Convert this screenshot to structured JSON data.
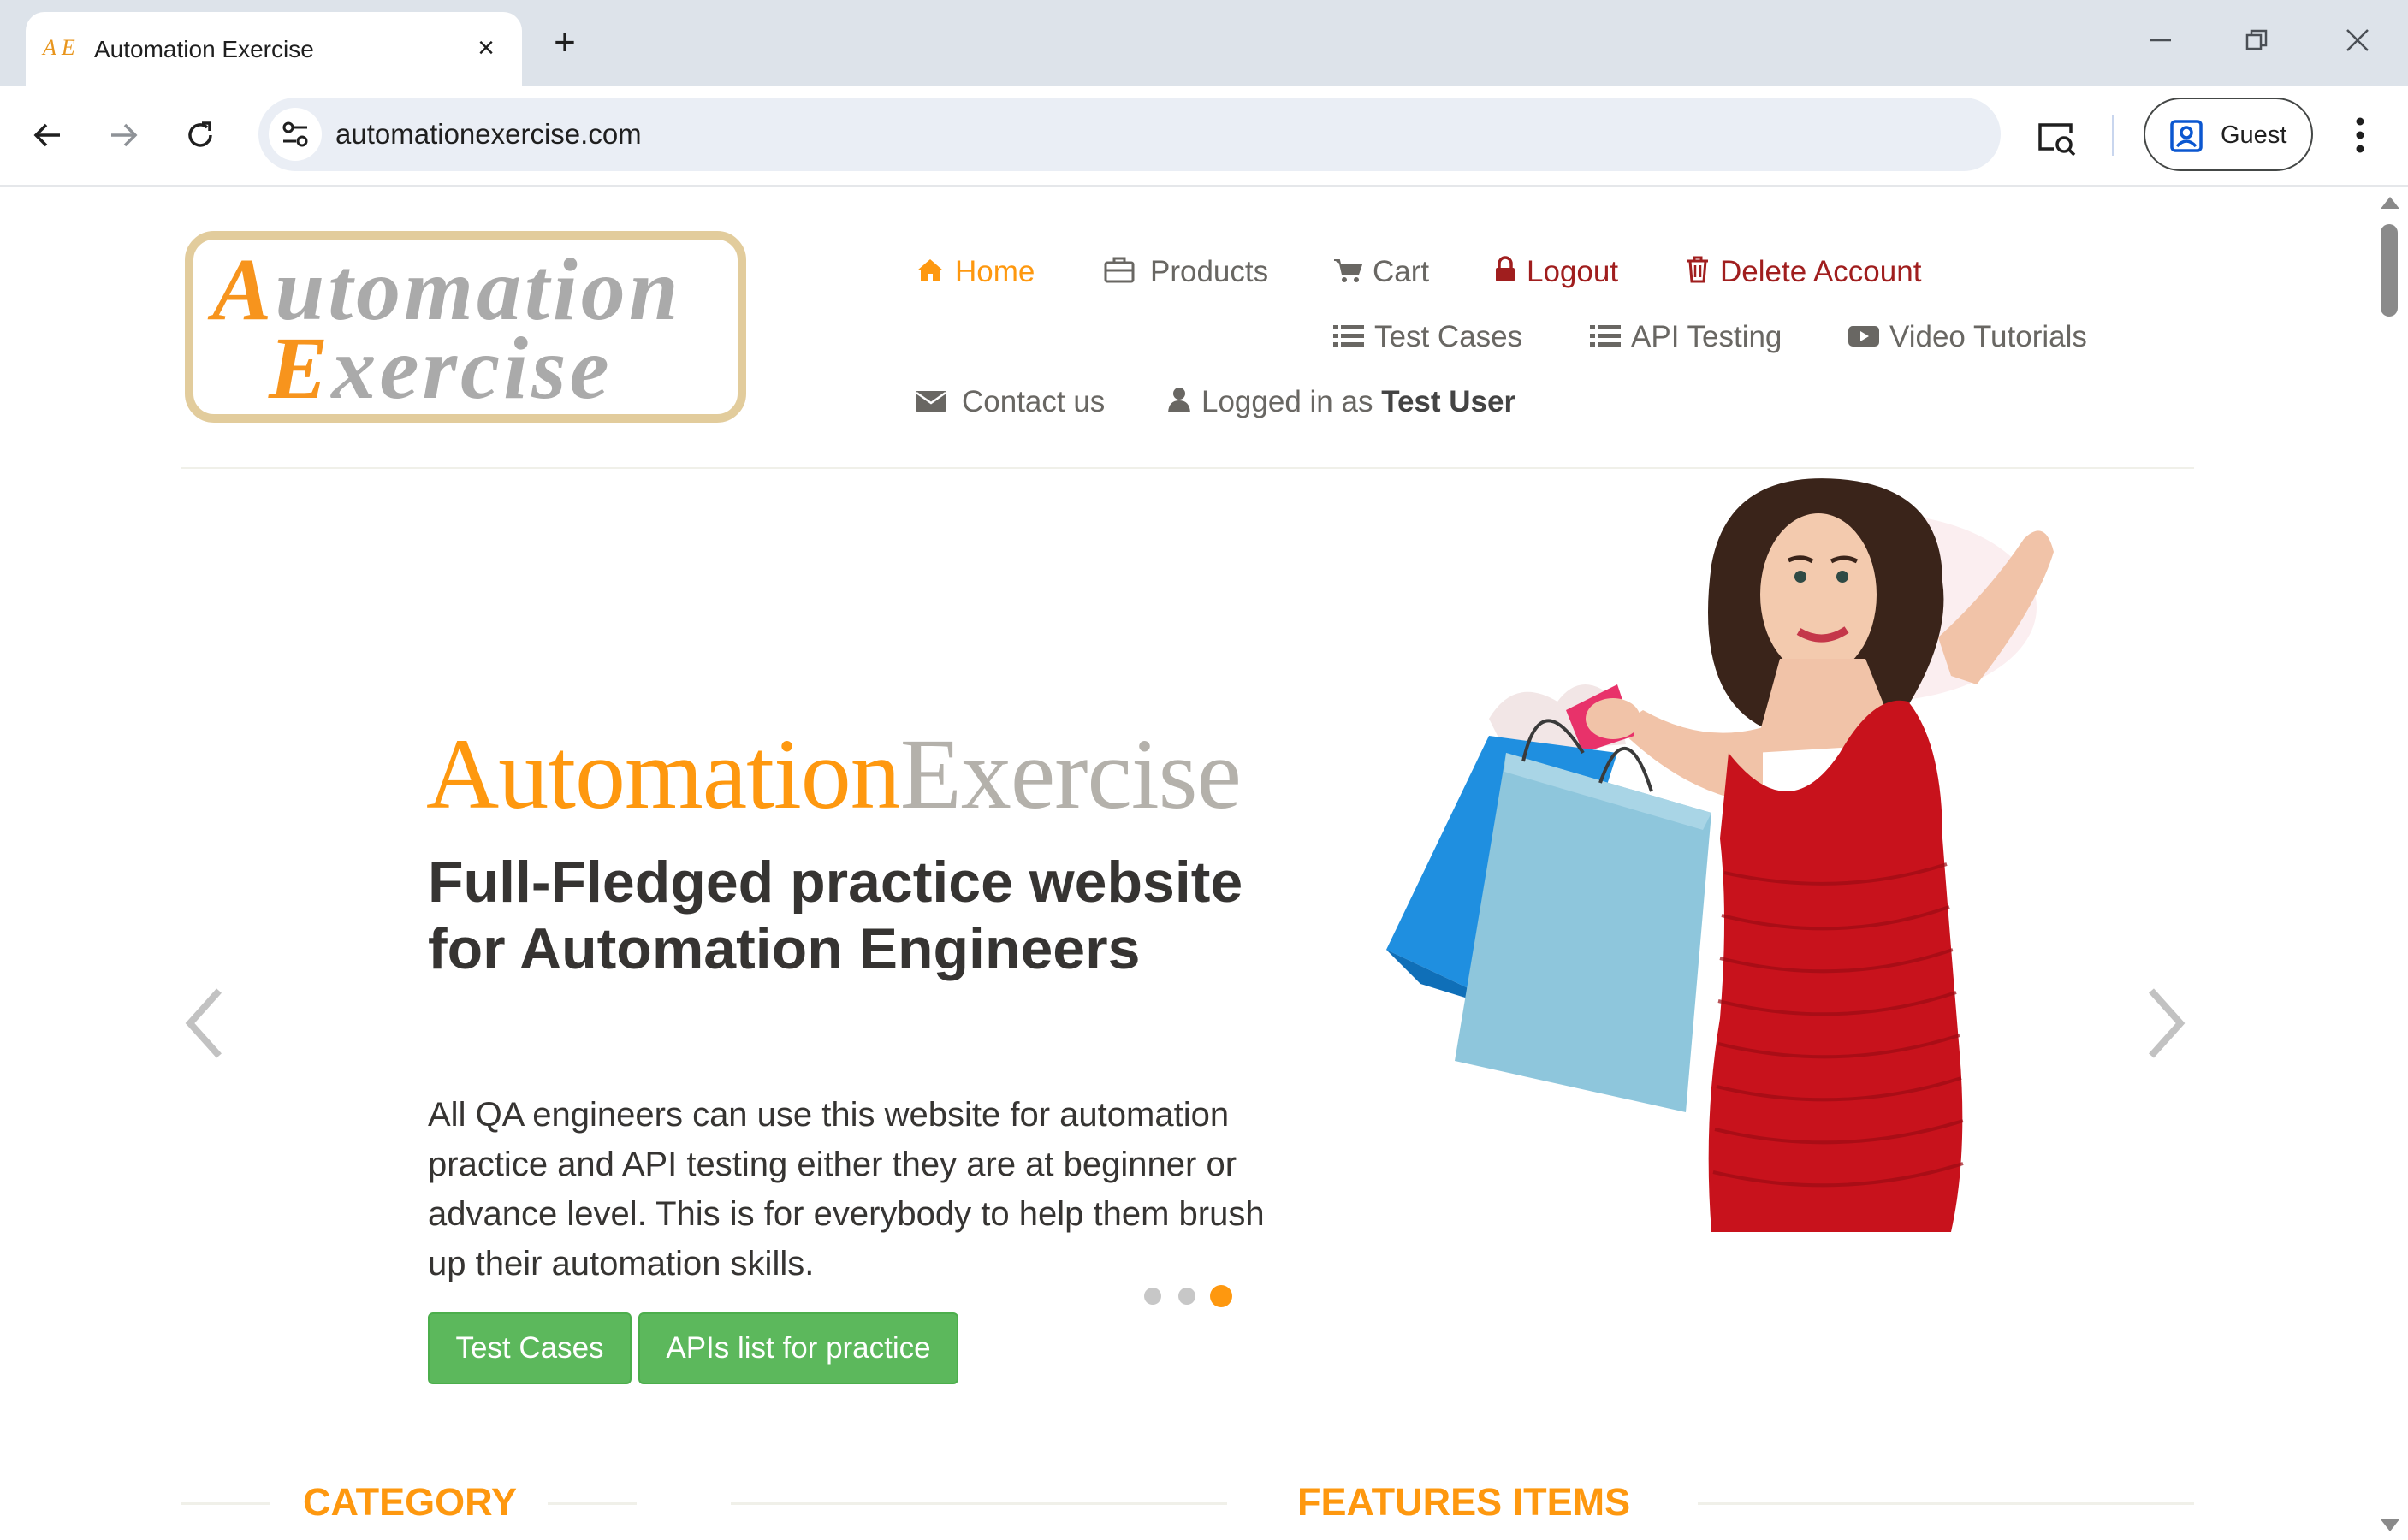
{
  "browser": {
    "tab_title": "Automation Exercise",
    "tab_favicon": "A E",
    "url": "automationexercise.com",
    "profile_label": "Guest"
  },
  "site": {
    "logo_line1_first": "A",
    "logo_line1_rest": "utomation",
    "logo_line2_first": "E",
    "logo_line2_rest": "xercise",
    "nav": {
      "home": "Home",
      "products": "Products",
      "cart": "Cart",
      "logout": "Logout",
      "delete_account": "Delete Account",
      "test_cases": "Test Cases",
      "api_testing": "API Testing",
      "video_tutorials": "Video Tutorials",
      "contact_us": "Contact us",
      "logged_in_prefix": "Logged in as",
      "logged_in_user": "Test User"
    }
  },
  "slider": {
    "brand_part1": "Automation",
    "brand_part2": "Exercise",
    "heading": "Full-Fledged practice website for Automation Engineers",
    "text": "All QA engineers can use this website for automation practice and API testing either they are at beginner or advance level. This is for everybody to help them brush up their automation skills.",
    "btn_test_cases": "Test Cases",
    "btn_apis": "APIs list for practice",
    "active_slide": 3,
    "slide_count": 3
  },
  "sections": {
    "category": "CATEGORY",
    "features": "FEATURES ITEMS"
  },
  "colors": {
    "accent": "#fe980f",
    "danger": "#a01e1e",
    "button_green": "#5cb85c",
    "text": "#696763"
  }
}
